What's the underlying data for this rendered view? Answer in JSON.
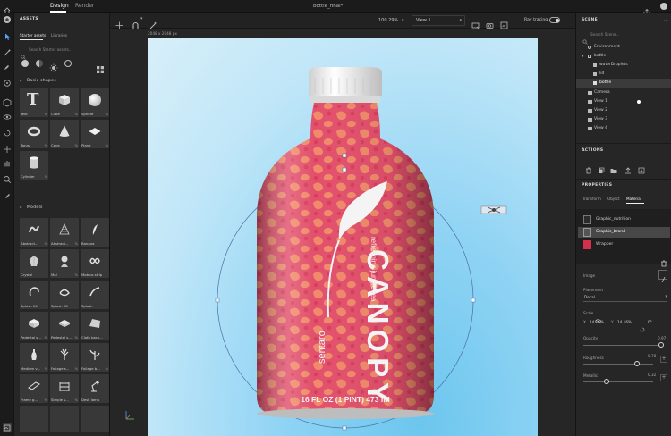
{
  "topbar": {
    "tabs": [
      "Design",
      "Render"
    ],
    "document_title": "bottle_final*"
  },
  "viewport": {
    "zoom": "100.29%",
    "view": "View 1",
    "ray_tracing_label": "Ray tracing",
    "canvas_size_label": "2048 x 2048 px"
  },
  "assets": {
    "title": "ASSETS",
    "tabs": [
      "Starter assets",
      "Libraries"
    ],
    "search_placeholder": "Search Starter assets...",
    "basic_shapes_header": "Basic shapes",
    "basic_shapes": [
      {
        "name": "Text",
        "pct": "%"
      },
      {
        "name": "Cube",
        "pct": "%"
      },
      {
        "name": "Sphere",
        "pct": "%"
      },
      {
        "name": "Torus",
        "pct": "%"
      },
      {
        "name": "Cone",
        "pct": "%"
      },
      {
        "name": "Plane",
        "pct": "%"
      },
      {
        "name": "Cylinder",
        "pct": "%"
      }
    ],
    "models_header": "Models",
    "models": [
      {
        "name": "Abstract...",
        "pct": "%"
      },
      {
        "name": "Abstract...",
        "pct": "%"
      },
      {
        "name": "Banana",
        "pct": ""
      },
      {
        "name": "Crystal",
        "pct": ""
      },
      {
        "name": "Mal",
        "pct": "%"
      },
      {
        "name": "Mobius strip",
        "pct": ""
      },
      {
        "name": "Splash 06",
        "pct": ""
      },
      {
        "name": "Splash 08",
        "pct": ""
      },
      {
        "name": "Splash",
        "pct": ""
      },
      {
        "name": "Pedestal s...",
        "pct": "%"
      },
      {
        "name": "Pedestal s...",
        "pct": "%"
      },
      {
        "name": "Cloth back...",
        "pct": ""
      },
      {
        "name": "Medium v...",
        "pct": "%"
      },
      {
        "name": "Foliage s...",
        "pct": "%"
      },
      {
        "name": "Foliage b...",
        "pct": "%"
      },
      {
        "name": "Frame g...",
        "pct": "%"
      },
      {
        "name": "Simple s...",
        "pct": "%"
      },
      {
        "name": "Desk lamp",
        "pct": ""
      }
    ]
  },
  "bottle": {
    "brand": "CANOPY",
    "tagline": "refreshing jungle tea",
    "vertical_brand": "sentaro",
    "volume": "16 FL OZ (1 PINT) 473 ml"
  },
  "scene": {
    "title": "SCENE",
    "search_placeholder": "Search Scene...",
    "items": [
      {
        "label": "Environment",
        "level": 1
      },
      {
        "label": "bottle",
        "level": 0
      },
      {
        "label": "waterDroplets",
        "level": 2
      },
      {
        "label": "lid",
        "level": 2
      },
      {
        "label": "bottle",
        "level": 2
      },
      {
        "label": "Camera",
        "level": 1
      },
      {
        "label": "View 1",
        "level": 1
      },
      {
        "label": "View 2",
        "level": 1
      },
      {
        "label": "View 3",
        "level": 1
      },
      {
        "label": "View 4",
        "level": 1
      }
    ]
  },
  "actions": {
    "title": "ACTIONS"
  },
  "properties": {
    "title": "PROPERTIES",
    "tabs": [
      "Transform",
      "Object",
      "Material"
    ],
    "materials": [
      "Graphic_nutrition",
      "Graphic_brand",
      "Wrapper"
    ],
    "image_label": "Image",
    "placement_label": "Placement",
    "placement_value": "Decal",
    "scale_label": "Scale",
    "scale_x_label": "X",
    "scale_x": "14.16%",
    "scale_y_label": "Y",
    "scale_y": "14.16%",
    "rotation": "0°",
    "opacity_label": "Opacity",
    "opacity_value": "0.97",
    "roughness_label": "Roughness",
    "roughness_value": "0.78",
    "metallic_label": "Metallic",
    "metallic_value": "0.32"
  },
  "colors": {
    "bottle_pink": "#e2506c",
    "bottle_orange": "#f08a6a",
    "accent_blue": "#4a90d9",
    "wrapper_swatch": "#d4304c"
  }
}
